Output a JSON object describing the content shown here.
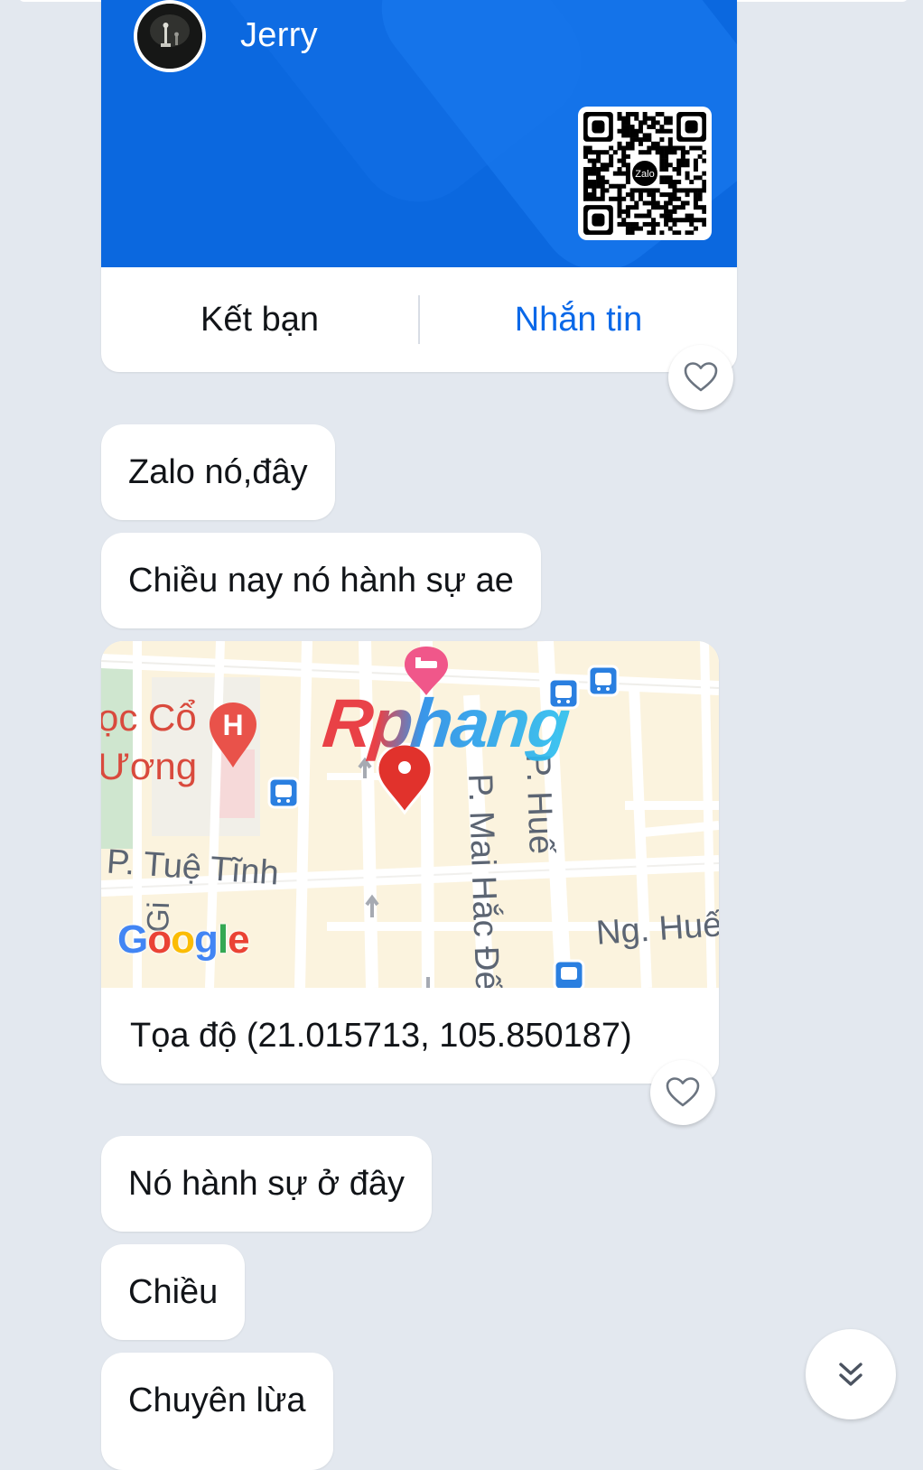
{
  "contact_card": {
    "name": "Jerry",
    "qr_logo_text": "Zalo",
    "actions": {
      "add_friend_label": "Kết bạn",
      "message_label": "Nhắn tin"
    },
    "accent_color": "#0b68df"
  },
  "messages": [
    {
      "text": "Zalo nó,đây"
    },
    {
      "text": "Chiều nay nó hành sự ae"
    },
    {
      "text": "Nó hành sự ở đây"
    },
    {
      "text": "Chiều"
    },
    {
      "text": "Chuyên lừa"
    }
  ],
  "map_message": {
    "coordinates_text": "Tọa độ (21.015713, 105.850187)",
    "watermark": "Rphang",
    "labels": {
      "hospital": "ọc Cổ\nƯơng",
      "street_tue_tinh": "P. Tuệ Tĩnh",
      "street_mai_hac_de": "P. Mai Hắc Đế",
      "street_hue": "P. Huế",
      "street_ng_hue": "Ng. Huế",
      "street_giang": "Gi"
    },
    "google_logo": {
      "letters": [
        "G",
        "o",
        "o",
        "g",
        "l",
        "e"
      ],
      "colors": [
        "#4285F4",
        "#EA4335",
        "#FBBC05",
        "#4285F4",
        "#34A853",
        "#EA4335"
      ]
    },
    "icons": [
      "hotel-pin-icon",
      "hospital-pin-icon",
      "location-pin-icon",
      "bus-stop-icon"
    ]
  },
  "reactions": {
    "icon": "heart-outline-icon"
  },
  "scroll_button": {
    "icon": "double-chevron-down-icon"
  }
}
